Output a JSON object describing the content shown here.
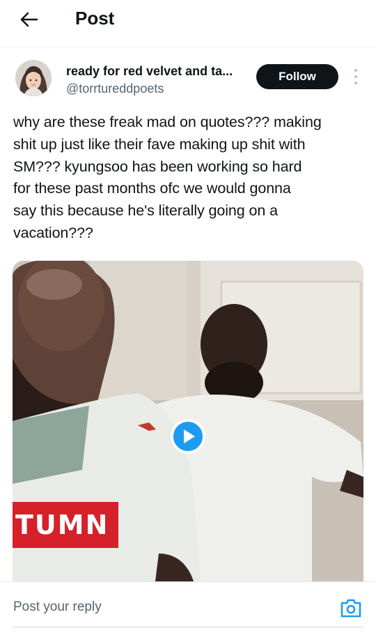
{
  "header": {
    "title": "Post",
    "back_icon": "arrow-left-icon"
  },
  "author": {
    "display_name": "ready for red velvet and ta...",
    "handle": "@torrtureddpoets",
    "follow_label": "Follow",
    "more_icon": "more-vertical-icon"
  },
  "tweet": {
    "text": "why are these freak mad on quotes??? making\nshit up just like their fave making up shit with\nSM??? kyungsoo has been working so hard\nfor these past months ofc we would gonna\nsay this because he's literally going on a\nvacation???"
  },
  "media": {
    "type": "video",
    "play_icon": "play-icon",
    "shirt_text": "TUMN"
  },
  "reply": {
    "placeholder": "Post your reply",
    "camera_icon": "camera-icon"
  },
  "colors": {
    "accent": "#1d9bf0",
    "text": "#0f1419",
    "muted": "#536471",
    "button_dark": "#0f1419"
  }
}
